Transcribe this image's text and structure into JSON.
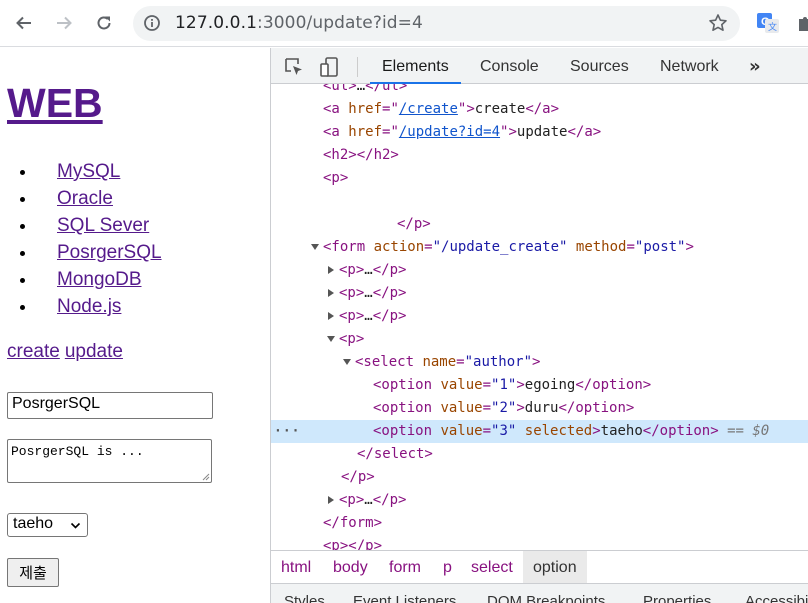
{
  "browser": {
    "url_host": "127.0.0.1",
    "url_rest": ":3000/update?id=4",
    "icons": [
      "back-arrow-icon",
      "forward-arrow-icon",
      "reload-icon",
      "info-icon",
      "star-icon",
      "translate-extension-icon",
      "extensions-puzzle-icon"
    ]
  },
  "page": {
    "title": "WEB",
    "list": [
      "MySQL",
      "Oracle",
      "SQL Sever",
      "PosrgerSQL",
      "MongoDB",
      "Node.js"
    ],
    "create_link": "create",
    "update_link": "update",
    "title_value": "PosrgerSQL",
    "description_value": "PosrgerSQL is ...",
    "author_selected": "taeho",
    "submit_label": "제출"
  },
  "devtools": {
    "tabs": [
      "Elements",
      "Console",
      "Sources",
      "Network"
    ],
    "more": "»",
    "tree": [
      {
        "indent": 52,
        "html": "<span class='tag'>&lt;ul&gt;</span><span class='txt'>…</span><span class='tag'>&lt;/ul&gt;</span>"
      },
      {
        "indent": 52,
        "html": "<span class='tag'>&lt;a </span><span class='attr'>href</span><span class='tag'>=\"</span><span class='link'>/create</span><span class='tag'>\"&gt;</span><span class='txt'>create</span><span class='tag'>&lt;/a&gt;</span>"
      },
      {
        "indent": 52,
        "html": "<span class='tag'>&lt;a </span><span class='attr'>href</span><span class='tag'>=\"</span><span class='link'>/update?id=4</span><span class='tag'>\"&gt;</span><span class='txt'>update</span><span class='tag'>&lt;/a&gt;</span>"
      },
      {
        "indent": 52,
        "html": "<span class='tag'>&lt;h2&gt;&lt;/h2&gt;</span>"
      },
      {
        "indent": 52,
        "html": "<span class='tag'>&lt;p&gt;</span>"
      },
      {
        "indent": 52,
        "html": ""
      },
      {
        "indent": 126,
        "html": "<span class='tag'>&lt;/p&gt;</span>"
      },
      {
        "indent": 52,
        "twisty": "down",
        "html": "<span class='tag'>&lt;form </span><span class='attr'>action</span><span class='tag'>=</span><span class='val'>\"/update_create\"</span><span class='tag'> </span><span class='attr'>method</span><span class='tag'>=</span><span class='val'>\"post\"</span><span class='tag'>&gt;</span>"
      },
      {
        "indent": 68,
        "twisty": "right",
        "html": "<span class='tag'>&lt;p&gt;</span><span class='txt'>…</span><span class='tag'>&lt;/p&gt;</span>"
      },
      {
        "indent": 68,
        "twisty": "right",
        "html": "<span class='tag'>&lt;p&gt;</span><span class='txt'>…</span><span class='tag'>&lt;/p&gt;</span>"
      },
      {
        "indent": 68,
        "twisty": "right",
        "html": "<span class='tag'>&lt;p&gt;</span><span class='txt'>…</span><span class='tag'>&lt;/p&gt;</span>"
      },
      {
        "indent": 68,
        "twisty": "down",
        "html": "<span class='tag'>&lt;p&gt;</span>"
      },
      {
        "indent": 84,
        "twisty": "down",
        "html": "<span class='tag'>&lt;select </span><span class='attr'>name</span><span class='tag'>=</span><span class='val'>\"author\"</span><span class='tag'>&gt;</span>"
      },
      {
        "indent": 102,
        "html": "<span class='tag'>&lt;option </span><span class='attr'>value</span><span class='tag'>=</span><span class='val'>\"1\"</span><span class='tag'>&gt;</span><span class='txt'>egoing</span><span class='tag'>&lt;/option&gt;</span>"
      },
      {
        "indent": 102,
        "html": "<span class='tag'>&lt;option </span><span class='attr'>value</span><span class='tag'>=</span><span class='val'>\"2\"</span><span class='tag'>&gt;</span><span class='txt'>duru</span><span class='tag'>&lt;/option&gt;</span>"
      },
      {
        "indent": 102,
        "selected": true,
        "html": "<span class='tag'>&lt;option </span><span class='attr'>value</span><span class='tag'>=</span><span class='val'>\"3\"</span><span class='tag'> </span><span class='attr'>selected</span><span class='tag'>&gt;</span><span class='txt'>taeho</span><span class='tag'>&lt;/option&gt;</span> <span class='eq'>== $0</span>"
      },
      {
        "indent": 86,
        "html": "<span class='tag'>&lt;/select&gt;</span>"
      },
      {
        "indent": 70,
        "html": "<span class='tag'>&lt;/p&gt;</span>"
      },
      {
        "indent": 68,
        "twisty": "right",
        "html": "<span class='tag'>&lt;p&gt;</span><span class='txt'>…</span><span class='tag'>&lt;/p&gt;</span>"
      },
      {
        "indent": 52,
        "html": "<span class='tag'>&lt;/form&gt;</span>"
      },
      {
        "indent": 52,
        "html": "<span class='tag'>&lt;p&gt;&lt;/p&gt;</span>"
      }
    ],
    "selected_row_marker": "···",
    "breadcrumbs": [
      "html",
      "body",
      "form",
      "p",
      "select",
      "option"
    ],
    "bottom_tabs": [
      "Styles",
      "Event Listeners",
      "DOM Breakpoints",
      "Properties",
      "Accessibility"
    ]
  }
}
